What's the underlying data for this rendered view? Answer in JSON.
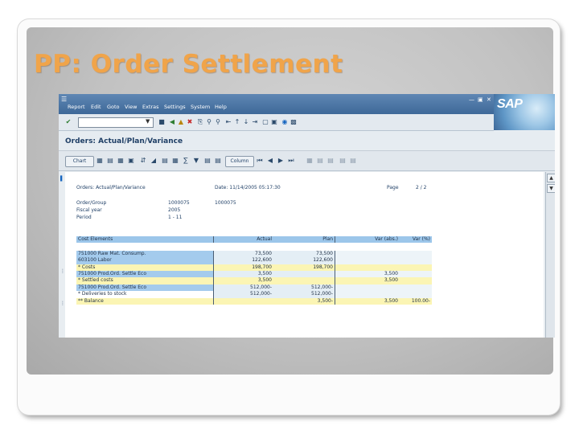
{
  "slide": {
    "title": "PP: Order Settlement"
  },
  "sap": {
    "logo": "SAP",
    "menu": [
      "Report",
      "Edit",
      "Goto",
      "View",
      "Extras",
      "Settings",
      "System",
      "Help"
    ],
    "window_controls": [
      "minimize-icon",
      "restore-icon",
      "close-icon"
    ],
    "screen_title": "Orders: Actual/Plan/Variance",
    "toolbar2_buttons": [
      "Chart",
      "Column"
    ],
    "report_header": {
      "line1_left": "Orders: Actual/Plan/Variance",
      "line1_mid": "Date: 11/14/2005 05:17:30",
      "line1_right_label": "Page",
      "line1_right_value": "2 / 2",
      "fields": [
        {
          "label": "Order/Group",
          "v1": "1000075",
          "v2": "1000075"
        },
        {
          "label": "Fiscal year",
          "v1": "2005",
          "v2": ""
        },
        {
          "label": "Period",
          "v1": "1 - 11",
          "v2": ""
        }
      ]
    },
    "table": {
      "columns": [
        "Cost Elements",
        "Actual",
        "Plan",
        "Var (abs.)",
        "Var (%)"
      ],
      "rows": [
        {
          "style": "blue",
          "name": "751000  Raw Mat. Consump.",
          "actual": "73,500",
          "plan": "73,500",
          "var": "",
          "pct": ""
        },
        {
          "style": "blue",
          "name": "603100  Labor",
          "actual": "122,600",
          "plan": "122,600",
          "var": "",
          "pct": ""
        },
        {
          "style": "yellow",
          "name": "*      Costs",
          "actual": "198,700",
          "plan": "198,700",
          "var": "",
          "pct": ""
        },
        {
          "style": "blue",
          "name": "751000  Prod.Ord. Settle Eco",
          "actual": "3,500",
          "plan": "",
          "var": "3,500",
          "pct": ""
        },
        {
          "style": "yellow",
          "name": "*      Settled costs",
          "actual": "3,500",
          "plan": "",
          "var": "3,500",
          "pct": ""
        },
        {
          "style": "blue",
          "name": "751000  Prod.Ord. Settle Eco",
          "actual": "512,000-",
          "plan": "512,000-",
          "var": "",
          "pct": ""
        },
        {
          "style": "white",
          "name": "*      Deliveries to stock",
          "actual": "512,000-",
          "plan": "512,000-",
          "var": "",
          "pct": ""
        },
        {
          "style": "yellow",
          "name": "**       Balance",
          "actual": "",
          "plan": "3,500-",
          "var": "3,500",
          "pct": "100.00-"
        }
      ]
    }
  }
}
